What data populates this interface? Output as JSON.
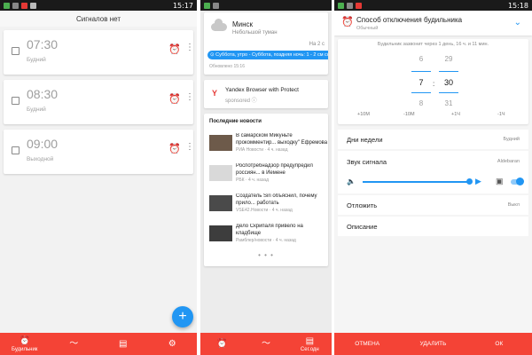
{
  "screen1": {
    "status_time": "15:17",
    "title": "Сигналов нет",
    "alarms": [
      {
        "time": "07:30",
        "label": "Будний"
      },
      {
        "time": "08:30",
        "label": "Будний"
      },
      {
        "time": "09:00",
        "label": "Выходной"
      }
    ],
    "fab": "+",
    "nav": {
      "alarm_label": "Будильник"
    }
  },
  "screen2": {
    "weather": {
      "city": "Минск",
      "desc": "Небольшой туман",
      "date": "На 2 с",
      "banner": "⊙ Суббота, утро - Суббота, поздняя ночь: 1 - 2 см снега",
      "updated": "Обновлено 15:16"
    },
    "ad": {
      "title": "Yandex Browser with Protect",
      "sub": "sponsored ⓘ",
      "logo": "Y"
    },
    "news": {
      "heading": "Последние новости",
      "items": [
        {
          "title": "В самарском Микуньте прокомментир... выходку\" Ефремова",
          "src": "РИА Новости · 4 ч. назад"
        },
        {
          "title": "Роспотребнадзор предупредил россиян... в Иемене",
          "src": "РБК · 4 ч. назад"
        },
        {
          "title": "Создатель Siri объяснил, почему прило... работать",
          "src": "VSE42.Новости · 4 ч. назад"
        },
        {
          "title": "Дело Скрипаля привело на кладбище",
          "src": "Рамблер/новости · 4 ч. назад"
        }
      ],
      "more": "• • •"
    },
    "nav": {
      "last_label": "Сег.одн"
    }
  },
  "screen3": {
    "status_time": "15:18",
    "header": {
      "title": "Способ отключения будильника",
      "sub": "Обычный"
    },
    "picker": {
      "info": "Будильник зазвонит через 1 день, 16 ч. и 11 мин.",
      "hours": [
        "6",
        "7",
        "8"
      ],
      "minutes": [
        "29",
        "30",
        "31"
      ],
      "colon": ":",
      "adjust": [
        "+10М",
        "-10М",
        "+1Ч",
        "-1Ч"
      ]
    },
    "days": {
      "label": "Дни недели",
      "value": "Будний"
    },
    "sound": {
      "label": "Звук сигнала",
      "value": "Aldebaran"
    },
    "snooze": {
      "label": "Отложить",
      "value": "Выкл"
    },
    "description": {
      "label": "Описание"
    },
    "actions": {
      "cancel": "ОТМЕНА",
      "delete": "УДАЛИТЬ",
      "ok": "ОК"
    }
  },
  "colors": {
    "accent": "#2196f3",
    "bar": "#f44336"
  }
}
